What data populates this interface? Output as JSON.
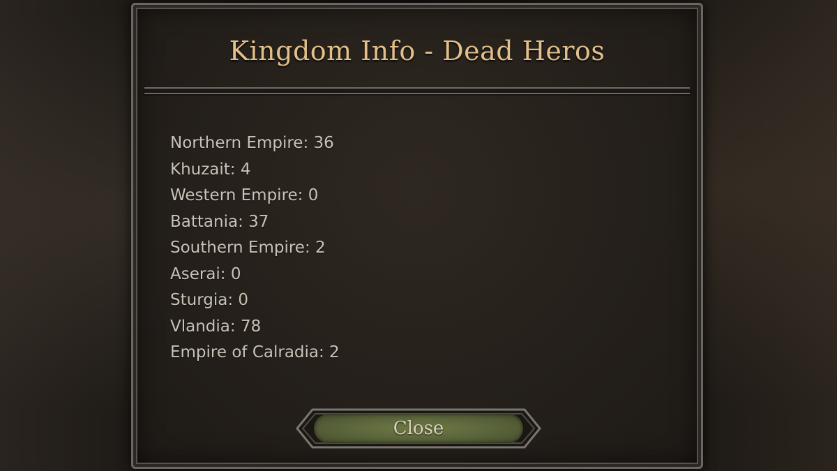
{
  "dialog": {
    "title": "Kingdom Info - Dead Heros",
    "stats": [
      "Northern Empire: 36",
      "Khuzait: 4",
      "Western Empire: 0",
      "Battania: 37",
      "Southern Empire: 2",
      "Aserai: 0",
      "Sturgia: 0",
      "Vlandia: 78",
      "Empire of Calradia: 2"
    ],
    "close_label": "Close"
  },
  "colors": {
    "title": "#e3bf8a",
    "text": "#c9c3b8",
    "button": "#59633a"
  }
}
